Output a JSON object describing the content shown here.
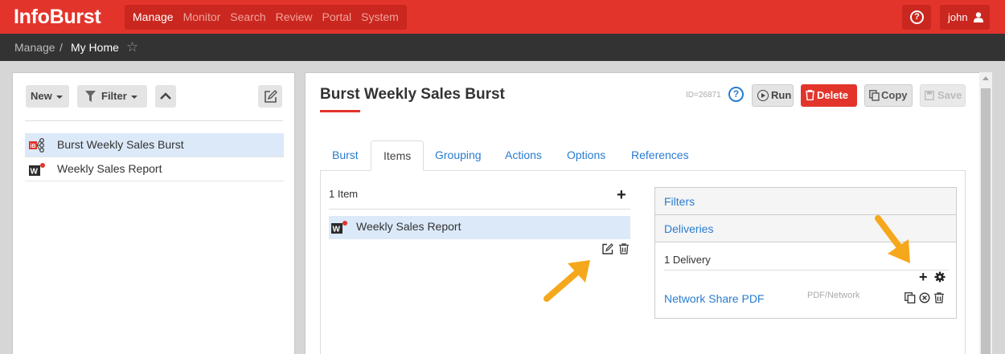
{
  "app": {
    "title": "InfoBurst"
  },
  "nav": {
    "items": [
      "Manage",
      "Monitor",
      "Search",
      "Review",
      "Portal",
      "System"
    ],
    "active": "Manage"
  },
  "user": {
    "name": "john"
  },
  "breadcrumb": {
    "root": "Manage",
    "separator": "/",
    "current": "My Home"
  },
  "left_panel": {
    "new_label": "New",
    "filter_label": "Filter",
    "tree": [
      {
        "label": "Burst Weekly Sales Burst",
        "icon": "burst-icon",
        "selected": true
      },
      {
        "label": "Weekly Sales Report",
        "icon": "webi-report-icon",
        "selected": false
      }
    ]
  },
  "detail": {
    "title": "Burst Weekly Sales Burst",
    "id_text": "ID=26871",
    "buttons": {
      "run": "Run",
      "delete": "Delete",
      "copy": "Copy",
      "save": "Save"
    },
    "tabs": [
      "Burst",
      "Items",
      "Grouping",
      "Actions",
      "Options",
      "References"
    ],
    "active_tab": "Items",
    "items": {
      "count_label": "1 Item",
      "rows": [
        {
          "label": "Weekly Sales Report",
          "icon": "webi-report-icon"
        }
      ]
    },
    "side": {
      "filters_label": "Filters",
      "deliveries_label": "Deliveries",
      "delivery_count": "1 Delivery",
      "deliveries": [
        {
          "name": "Network Share PDF",
          "type": "PDF/Network"
        }
      ]
    }
  },
  "colors": {
    "brand": "#e3342b",
    "link": "#2a7ccf",
    "selected_row": "#dbe9f9",
    "annotation_arrow": "#f5a81c"
  }
}
